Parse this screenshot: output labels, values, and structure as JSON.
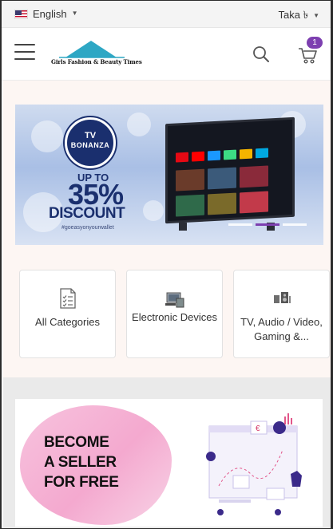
{
  "topbar": {
    "language_label": "English",
    "currency_label": "Taka ৳"
  },
  "header": {
    "logo_text": "Girls Fashion & Beauty Times",
    "cart_count": "1"
  },
  "banner": {
    "badge_line1": "TV",
    "badge_line2": "BONANZA",
    "up_to": "UP TO",
    "percent": "35%",
    "discount": "DISCOUNT",
    "hashtag": "#goeasyonyourwallet",
    "slide_count": 3,
    "active_slide": 2
  },
  "categories": [
    {
      "label": "All Categories",
      "icon": "checklist-icon"
    },
    {
      "label": "Electronic Devices",
      "icon": "electronics-icon"
    },
    {
      "label": "TV, Audio / Video, Gaming &...",
      "icon": "tv-audio-icon"
    }
  ],
  "seller_banner": {
    "line1": "BECOME",
    "line2": "A SELLER",
    "line3": "FOR FREE"
  },
  "colors": {
    "accent": "#7d3fb0",
    "logo_teal": "#2ea7c4",
    "banner_navy": "#1a2f6e",
    "blob_pink": "#f4a9cf"
  }
}
